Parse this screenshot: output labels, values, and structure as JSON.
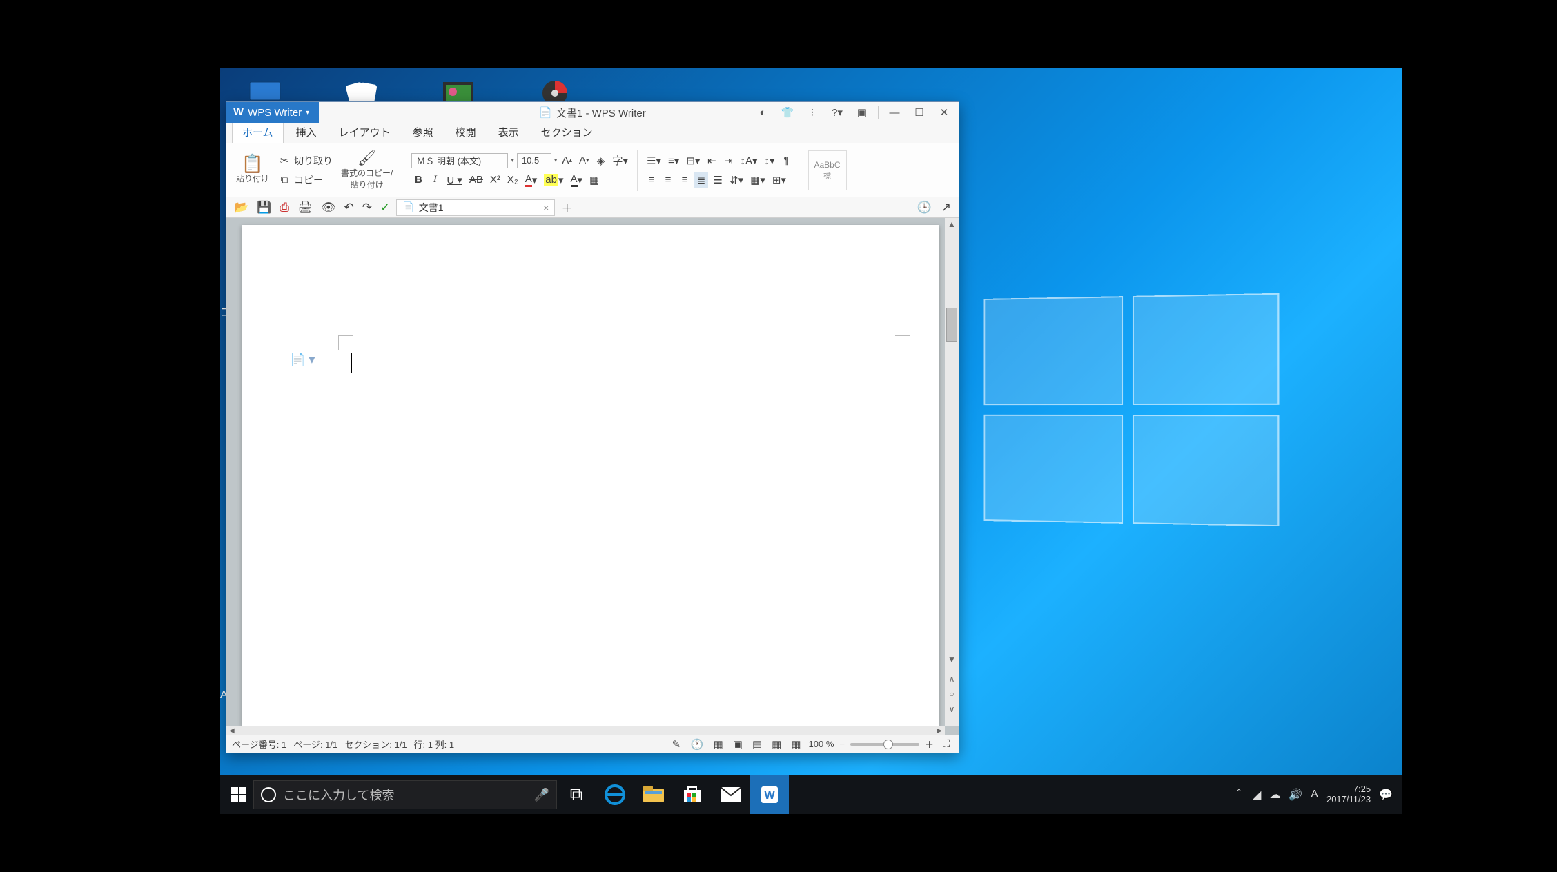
{
  "app": {
    "name": "WPS Writer",
    "doc_title_full": "文書1 - WPS Writer"
  },
  "tabs": {
    "home": "ホーム",
    "insert": "挿入",
    "layout": "レイアウト",
    "ref": "参照",
    "review": "校閲",
    "view": "表示",
    "section": "セクション"
  },
  "ribbon": {
    "paste": "貼り付け",
    "cut": "切り取り",
    "copy": "コピー",
    "format_painter": "書式のコピー/\n貼り付け",
    "font_name": "ＭＳ 明朝 (本文)",
    "font_size": "10.5",
    "style_label": "AaBbC",
    "style_name": "標"
  },
  "doc_tab": {
    "name": "文書1"
  },
  "statusbar": {
    "page_num": "ページ番号: 1",
    "page": "ページ: 1/1",
    "section": "セクション: 1/1",
    "pos": "行: 1 列: 1",
    "zoom": "100 %"
  },
  "search_placeholder": "ここに入力して検索",
  "clock": {
    "time": "7:25",
    "date": "2017/11/23"
  },
  "desktop_labels": {
    "acr": "Acr",
    "co": "コ"
  }
}
